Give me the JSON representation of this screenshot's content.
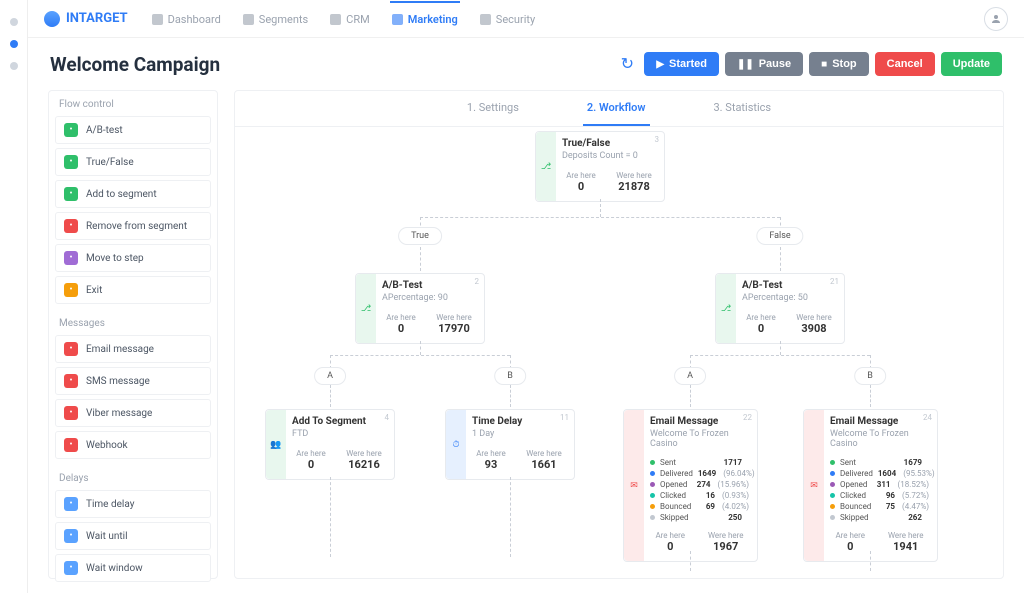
{
  "brand": "INTARGET",
  "nav": [
    {
      "id": "dashboard",
      "label": "Dashboard",
      "active": false
    },
    {
      "id": "segments",
      "label": "Segments",
      "active": false
    },
    {
      "id": "crm",
      "label": "CRM",
      "active": false
    },
    {
      "id": "marketing",
      "label": "Marketing",
      "active": true
    },
    {
      "id": "security",
      "label": "Security",
      "active": false
    }
  ],
  "page_title": "Welcome Campaign",
  "actions": {
    "refresh_icon": "↻",
    "started": "Started",
    "pause": "Pause",
    "stop": "Stop",
    "cancel": "Cancel",
    "update": "Update"
  },
  "tabs": [
    {
      "id": "settings",
      "label": "1. Settings",
      "active": false
    },
    {
      "id": "workflow",
      "label": "2. Workflow",
      "active": true
    },
    {
      "id": "statistics",
      "label": "3. Statistics",
      "active": false
    }
  ],
  "sidebar": {
    "flow_label": "Flow control",
    "flow": [
      {
        "id": "abtest",
        "label": "A/B-test",
        "icon": "share"
      },
      {
        "id": "truefalse",
        "label": "True/False",
        "icon": "tf"
      },
      {
        "id": "addseg",
        "label": "Add to segment",
        "icon": "addseg"
      },
      {
        "id": "remseg",
        "label": "Remove from segment",
        "icon": "remseg"
      },
      {
        "id": "movestep",
        "label": "Move to step",
        "icon": "move"
      },
      {
        "id": "exit",
        "label": "Exit",
        "icon": "exit"
      }
    ],
    "messages_label": "Messages",
    "messages": [
      {
        "id": "email",
        "label": "Email message",
        "icon": "email"
      },
      {
        "id": "sms",
        "label": "SMS message",
        "icon": "sms"
      },
      {
        "id": "viber",
        "label": "Viber message",
        "icon": "viber"
      },
      {
        "id": "webhook",
        "label": "Webhook",
        "icon": "hook"
      }
    ],
    "delays_label": "Delays",
    "delays": [
      {
        "id": "timedelay",
        "label": "Time delay",
        "icon": "delay"
      },
      {
        "id": "waituntil",
        "label": "Wait until",
        "icon": "wait"
      },
      {
        "id": "waitwindow",
        "label": "Wait window",
        "icon": "window"
      }
    ]
  },
  "labels": {
    "are_here": "Are here",
    "were_here": "Were here"
  },
  "nodes": {
    "root": {
      "id": "3",
      "title": "True/False",
      "subtitle": "Deposits Count = 0",
      "are": "0",
      "were": "21878"
    },
    "ab_left": {
      "id": "2",
      "title": "A/B-Test",
      "subtitle": "APercentage: 90",
      "are": "0",
      "were": "17970"
    },
    "ab_right": {
      "id": "21",
      "title": "A/B-Test",
      "subtitle": "APercentage: 50",
      "are": "0",
      "were": "3908"
    },
    "addseg": {
      "id": "4",
      "title": "Add To Segment",
      "subtitle": "FTD",
      "are": "0",
      "were": "16216"
    },
    "delay": {
      "id": "11",
      "title": "Time Delay",
      "subtitle": "1 Day",
      "are": "93",
      "were": "1661"
    },
    "email_a": {
      "id": "22",
      "title": "Email Message",
      "subtitle": "Welcome To Frozen Casino",
      "are": "0",
      "were": "1967",
      "metrics": [
        {
          "name": "Sent",
          "color": "#2fbf6a",
          "value": "1717",
          "pct": ""
        },
        {
          "name": "Delivered",
          "color": "#2f7cf6",
          "value": "1649",
          "pct": "(96.04%)"
        },
        {
          "name": "Opened",
          "color": "#9b59b6",
          "value": "274",
          "pct": "(15.96%)"
        },
        {
          "name": "Clicked",
          "color": "#16c4a8",
          "value": "16",
          "pct": "(0.93%)"
        },
        {
          "name": "Bounced",
          "color": "#f59e0b",
          "value": "69",
          "pct": "(4.02%)"
        },
        {
          "name": "Skipped",
          "color": "#c2c8d0",
          "value": "250",
          "pct": ""
        }
      ]
    },
    "email_b": {
      "id": "24",
      "title": "Email Message",
      "subtitle": "Welcome To Frozen Casino",
      "are": "0",
      "were": "1941",
      "metrics": [
        {
          "name": "Sent",
          "color": "#2fbf6a",
          "value": "1679",
          "pct": ""
        },
        {
          "name": "Delivered",
          "color": "#2f7cf6",
          "value": "1604",
          "pct": "(95.53%)"
        },
        {
          "name": "Opened",
          "color": "#9b59b6",
          "value": "311",
          "pct": "(18.52%)"
        },
        {
          "name": "Clicked",
          "color": "#16c4a8",
          "value": "96",
          "pct": "(5.72%)"
        },
        {
          "name": "Bounced",
          "color": "#f59e0b",
          "value": "75",
          "pct": "(4.47%)"
        },
        {
          "name": "Skipped",
          "color": "#c2c8d0",
          "value": "262",
          "pct": ""
        }
      ]
    }
  },
  "pills": {
    "true": "True",
    "false": "False",
    "a": "A",
    "b": "B"
  }
}
